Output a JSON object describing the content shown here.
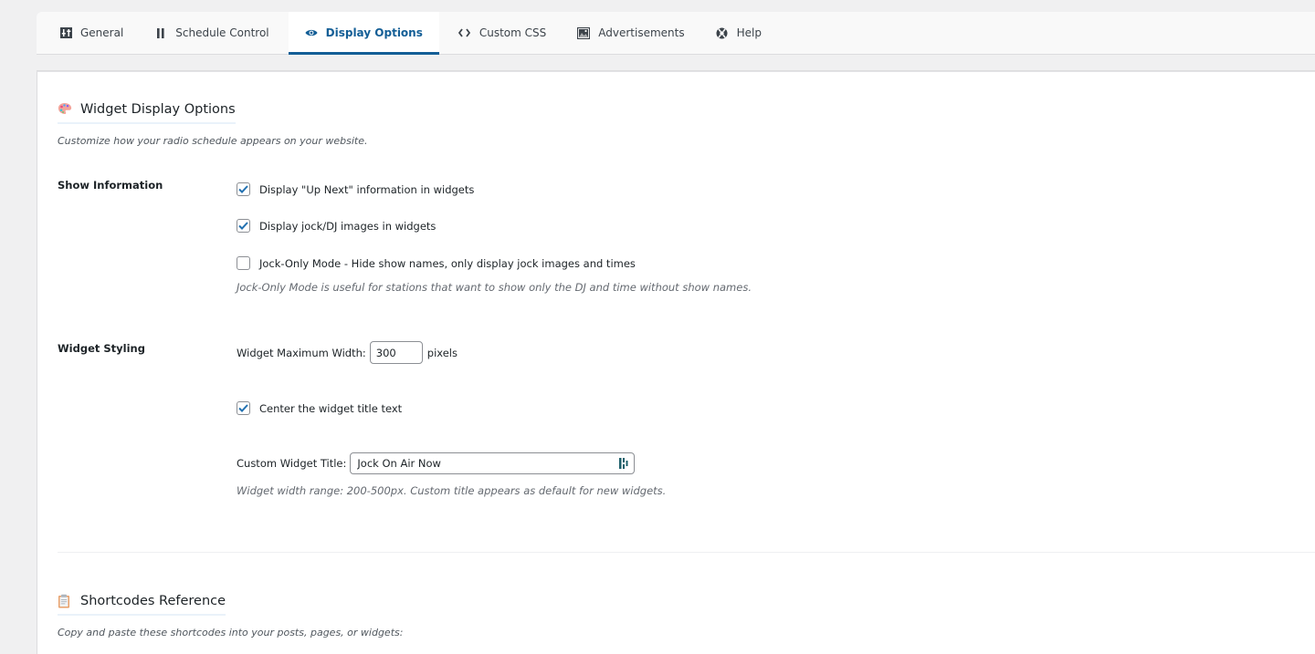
{
  "tabs": [
    {
      "label": "General",
      "icon": "sliders-icon",
      "active": false
    },
    {
      "label": "Schedule Control",
      "icon": "pause-icon",
      "active": false
    },
    {
      "label": "Display Options",
      "icon": "eye-icon",
      "active": true
    },
    {
      "label": "Custom CSS",
      "icon": "code-icon",
      "active": false
    },
    {
      "label": "Advertisements",
      "icon": "image-icon",
      "active": false
    },
    {
      "label": "Help",
      "icon": "lifebuoy-icon",
      "active": false
    }
  ],
  "display_section": {
    "icon": "palette-icon",
    "title": "Widget Display Options",
    "description": "Customize how your radio schedule appears on your website."
  },
  "show_information": {
    "label": "Show Information",
    "options": [
      {
        "label": "Display \"Up Next\" information in widgets",
        "checked": true
      },
      {
        "label": "Display jock/DJ images in widgets",
        "checked": true
      },
      {
        "label": "Jock-Only Mode - Hide show names, only display jock images and times",
        "checked": false
      }
    ],
    "help": "Jock-Only Mode is useful for stations that want to show only the DJ and time without show names."
  },
  "widget_styling": {
    "label": "Widget Styling",
    "max_width_label": "Widget Maximum Width:",
    "max_width_value": "300",
    "max_width_unit": "pixels",
    "center_title": {
      "label": "Center the widget title text",
      "checked": true
    },
    "custom_title_label": "Custom Widget Title:",
    "custom_title_value": "Jock On Air Now",
    "help": "Widget width range: 200-500px. Custom title appears as default for new widgets."
  },
  "shortcodes_section": {
    "icon": "clipboard-icon",
    "title": "Shortcodes Reference",
    "description": "Copy and paste these shortcodes into your posts, pages, or widgets:"
  },
  "colors": {
    "accent": "#135e96",
    "checkbox_check": "#2271b1"
  }
}
